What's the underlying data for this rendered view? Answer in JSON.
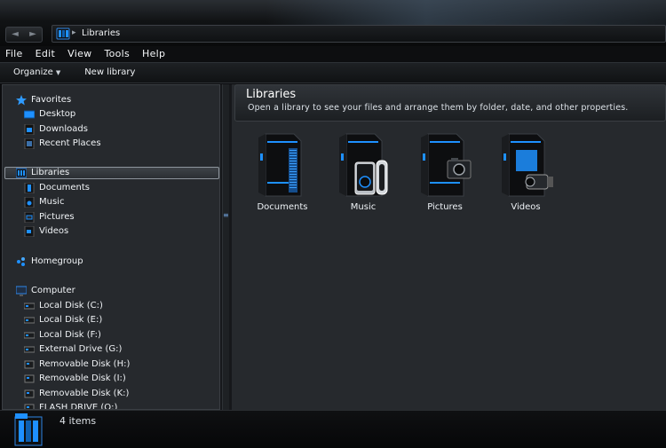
{
  "window": {
    "address": "Libraries"
  },
  "nav_buttons": {
    "back": "◄",
    "forward": "►"
  },
  "menu": [
    "File",
    "Edit",
    "View",
    "Tools",
    "Help"
  ],
  "toolbar": {
    "organize": "Organize",
    "new_library": "New library"
  },
  "navpane": {
    "favorites": {
      "label": "Favorites",
      "items": [
        "Desktop",
        "Downloads",
        "Recent Places"
      ]
    },
    "libraries": {
      "label": "Libraries",
      "items": [
        "Documents",
        "Music",
        "Pictures",
        "Videos"
      ]
    },
    "homegroup": {
      "label": "Homegroup"
    },
    "computer": {
      "label": "Computer",
      "items": [
        "Local Disk (C:)",
        "Local Disk  (E:)",
        "Local Disk (F:)",
        "External Drive (G:)",
        "Removable Disk (H:)",
        "Removable Disk (I:)",
        "Removable Disk (K:)",
        "FLASH DRIVE (Q:)"
      ]
    }
  },
  "content": {
    "title": "Libraries",
    "subtitle": "Open a library to see your files and arrange them by folder, date, and other properties.",
    "libraries": [
      "Documents",
      "Music",
      "Pictures",
      "Videos"
    ]
  },
  "status": {
    "count": "4 items"
  },
  "colors": {
    "accent": "#1e90ff",
    "background": "#26292d"
  }
}
